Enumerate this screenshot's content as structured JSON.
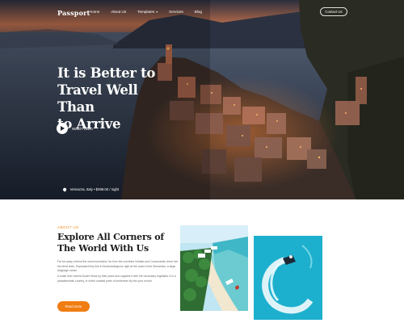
{
  "nav": {
    "logo": "Passport",
    "links": [
      {
        "label": "Home",
        "has_chevron": false
      },
      {
        "label": "About Us",
        "has_chevron": false
      },
      {
        "label": "Templates",
        "has_chevron": true
      },
      {
        "label": "Services",
        "has_chevron": false
      },
      {
        "label": "Blog",
        "has_chevron": false
      }
    ],
    "contact_label": "Contact Us"
  },
  "hero": {
    "title_lines": [
      "It is Better to",
      "Travel Well Than",
      "to Arrive"
    ],
    "watch_label": "Watch Video",
    "location": "Vernazza, Italy • $399.00 / night"
  },
  "about": {
    "tag": "ABOUT US",
    "title_lines": [
      "Explore All Corners of",
      "The World With Us"
    ],
    "paragraph1": "Far far away, behind the word mountains, far from the countries Vokalia and Consonantia, there live the blind texts. Separated they live in Bookmarksgrove right at the coast of the Semantics, a large language ocean.",
    "paragraph2": "A small river named Duden flows by their place and supplies it with the necessary regelialia. It is a paradisematic country, in which roasted parts of sentences fly into your mouth.",
    "button_label": "Read more"
  },
  "colors": {
    "accent": "#f07d12",
    "heading": "#1d1d1d",
    "hero_overlay": "#151a25"
  }
}
